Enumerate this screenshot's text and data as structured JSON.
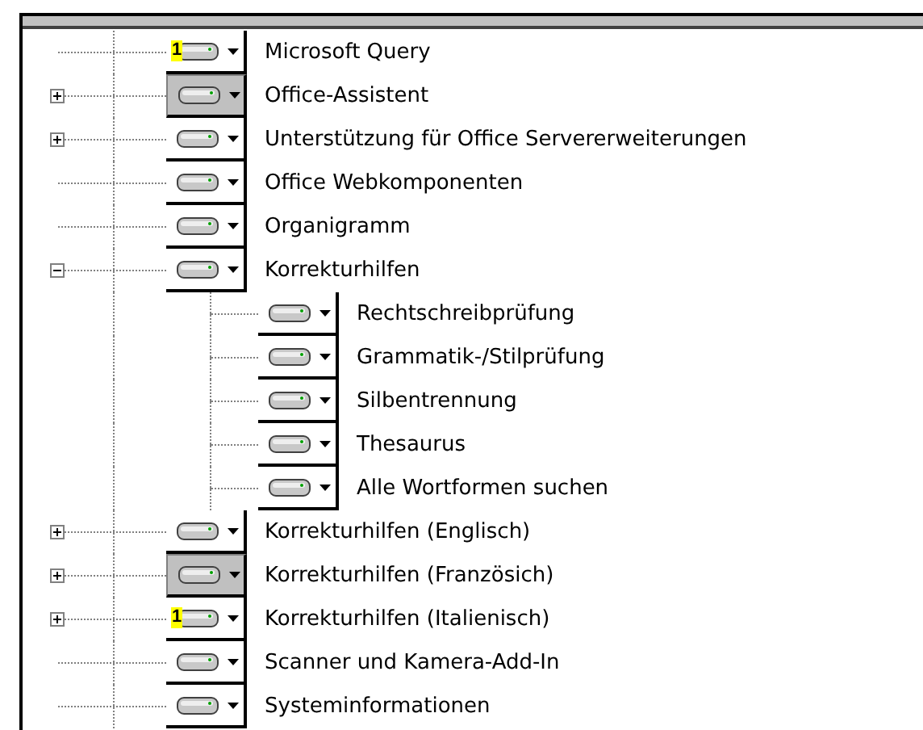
{
  "tree": {
    "items": [
      {
        "label": "Microsoft Query",
        "badge": "1",
        "partial": false
      },
      {
        "label": "Office-Assistent",
        "partial": true,
        "expanded": false
      },
      {
        "label": "Unterstützung für Office Servererweiterungen",
        "partial": false,
        "expanded": false
      },
      {
        "label": "Office Webkomponenten",
        "partial": false
      },
      {
        "label": "Organigramm",
        "partial": false
      },
      {
        "label": "Korrekturhilfen",
        "partial": false,
        "expanded": true,
        "children": [
          {
            "label": "Rechtschreibprüfung",
            "partial": false
          },
          {
            "label": "Grammatik-/Stilprüfung",
            "partial": false
          },
          {
            "label": "Silbentrennung",
            "partial": false
          },
          {
            "label": "Thesaurus",
            "partial": false
          },
          {
            "label": "Alle Wortformen suchen",
            "partial": false
          }
        ]
      },
      {
        "label": "Korrekturhilfen (Englisch)",
        "partial": false,
        "expanded": false
      },
      {
        "label": "Korrekturhilfen (Französich)",
        "partial": true,
        "expanded": false
      },
      {
        "label": "Korrekturhilfen (Italienisch)",
        "badge": "1",
        "partial": false,
        "expanded": false
      },
      {
        "label": "Scanner und Kamera-Add-In",
        "partial": false
      },
      {
        "label": "Systeminformationen",
        "partial": false
      }
    ]
  }
}
